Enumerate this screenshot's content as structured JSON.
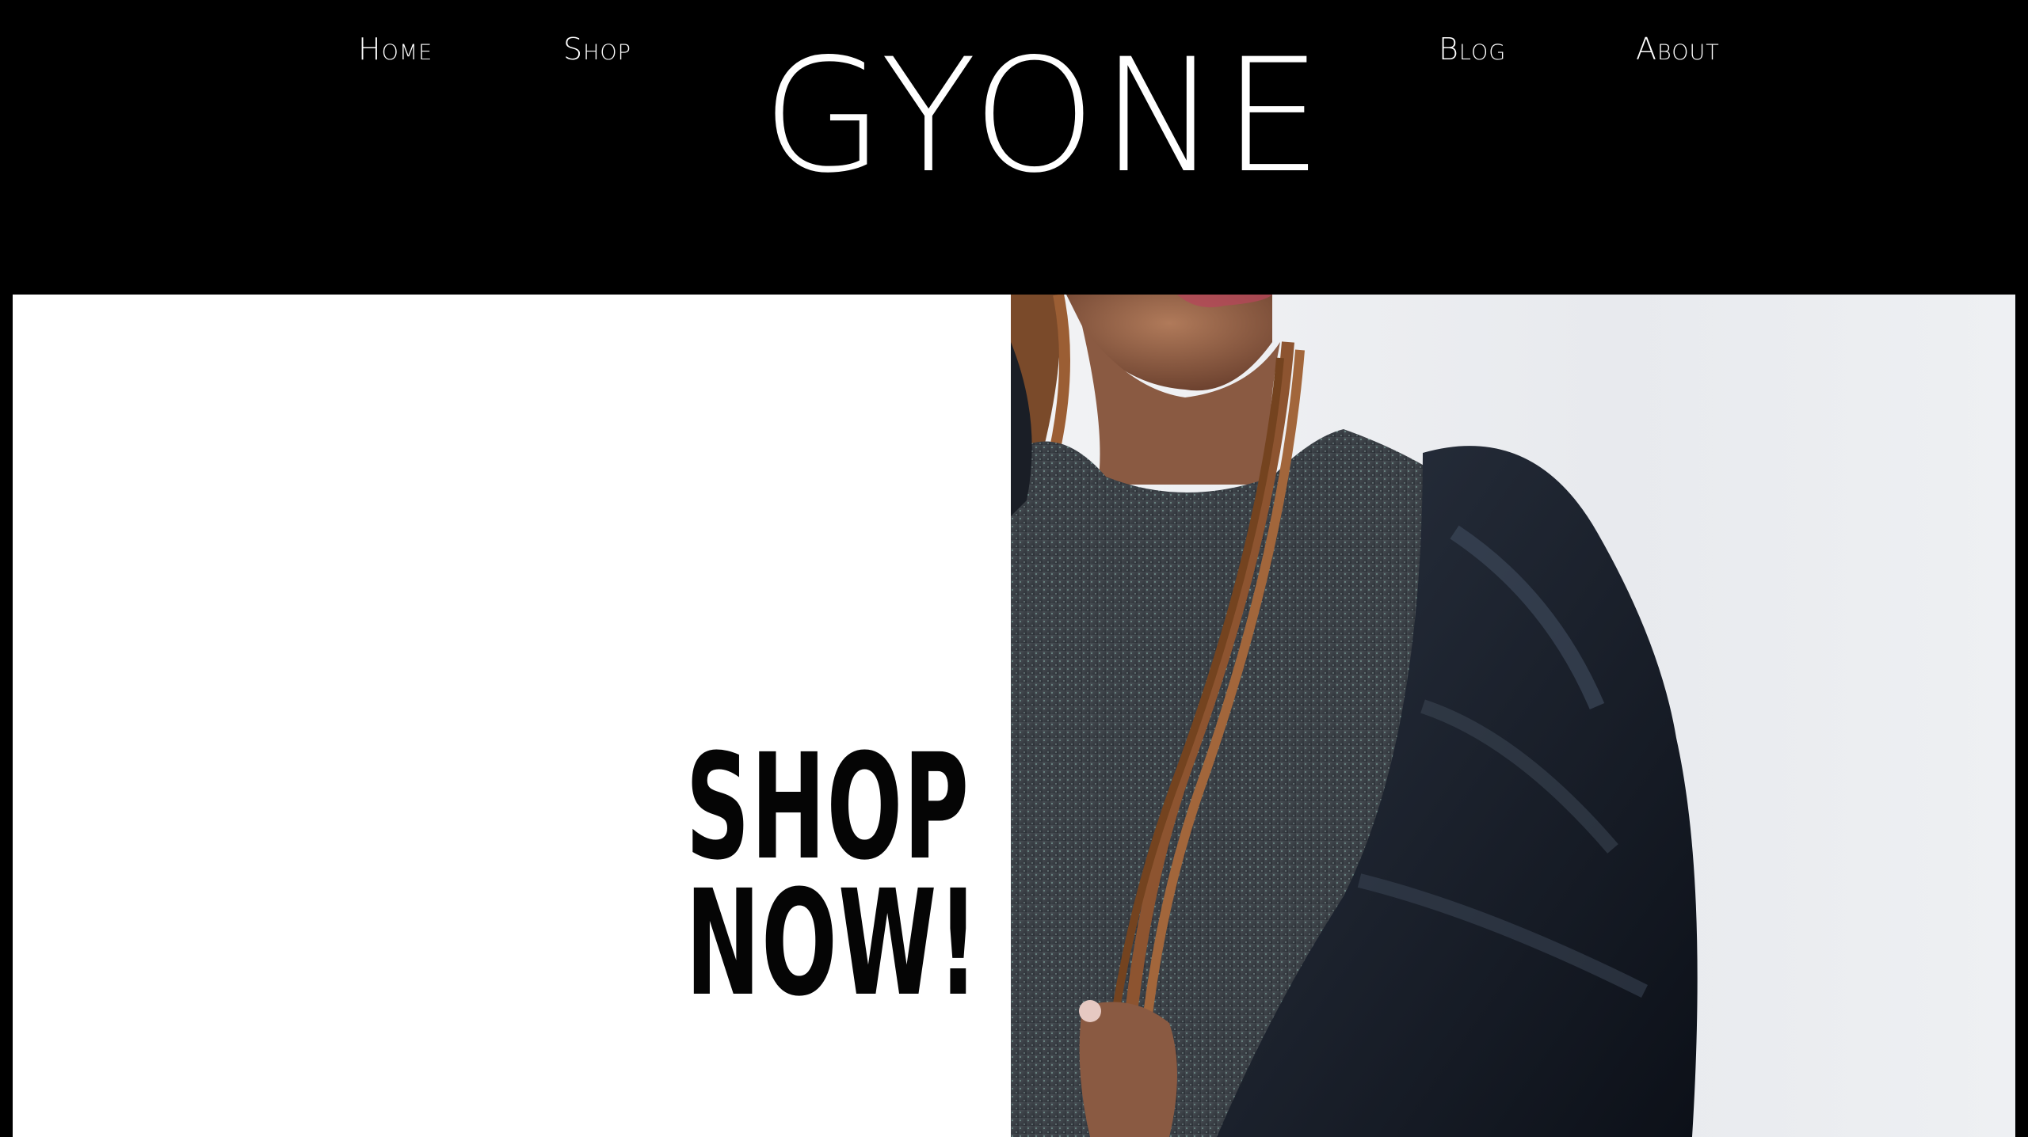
{
  "nav": {
    "home": "Home",
    "shop": "Shop",
    "blog": "Blog",
    "about": "About"
  },
  "brand": {
    "logo": "GYONE"
  },
  "hero": {
    "promo_line1": "SHOP",
    "promo_line2": "NOW!",
    "image_icon": "model-photo"
  },
  "colors": {
    "header_bg": "#000000",
    "header_text": "#ffffff",
    "hero_bg": "#ffffff",
    "promo_text": "#050505"
  }
}
